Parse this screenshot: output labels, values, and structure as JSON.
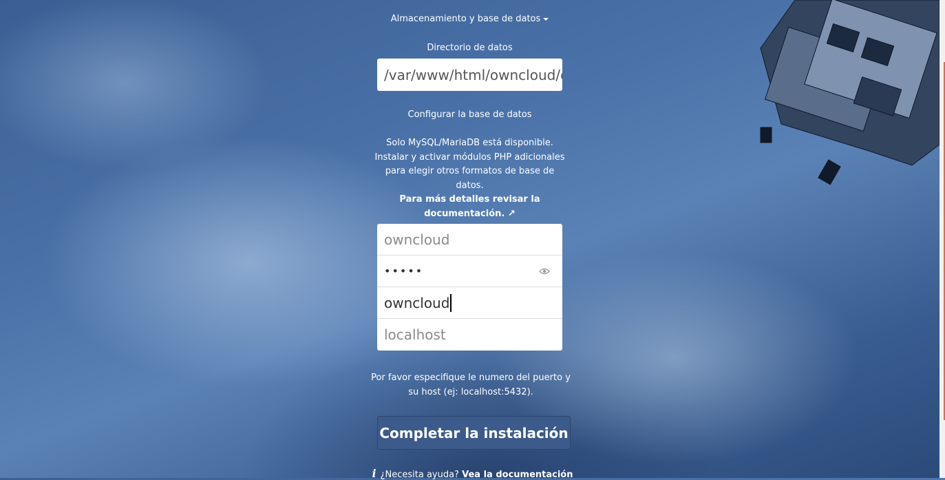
{
  "storage_toggle": {
    "label": "Almacenamiento y base de datos"
  },
  "data_dir": {
    "label": "Directorio de datos",
    "value": "/var/www/html/owncloud/d"
  },
  "db_config": {
    "label": "Configurar la base de datos",
    "info_text": "Solo MySQL/MariaDB está disponible. Instalar y activar módulos PHP adicionales para elegir otros formatos de base de datos.",
    "docs_link": "Para más detalles revisar la documentación. ↗"
  },
  "db_fields": {
    "user_placeholder": "owncloud",
    "password_value": "•••••",
    "db_name_value": "owncloud",
    "host_placeholder": "localhost"
  },
  "host_hint": "Por favor especifique le numero del puerto y su host (ej: localhost:5432).",
  "submit_label": "Completar la instalación",
  "help": {
    "text": "¿Necesita ayuda?",
    "link": "Vea la documentación"
  },
  "icons": {
    "toggle": "caret-down-icon",
    "password": "eye-icon",
    "help": "info-icon"
  }
}
